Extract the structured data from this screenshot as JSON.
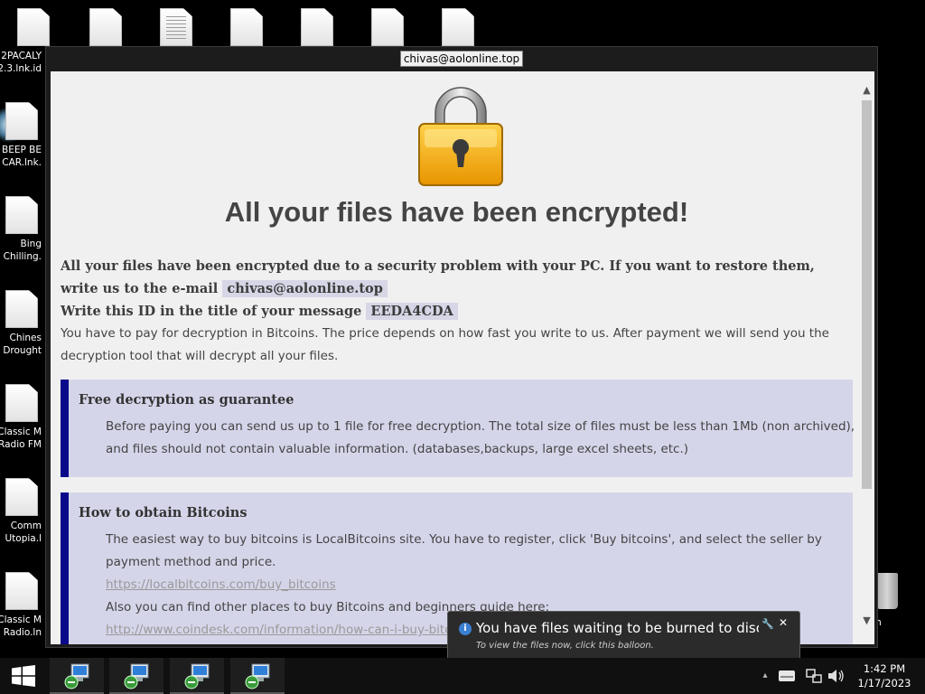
{
  "desktop": {
    "top_icons": [
      {
        "icon": "blank-file-icon"
      },
      {
        "icon": "blank-file-icon"
      },
      {
        "icon": "text-file-icon"
      },
      {
        "icon": "blank-file-icon"
      },
      {
        "icon": "blank-file-icon"
      },
      {
        "icon": "blank-file-icon"
      },
      {
        "icon": "blank-file-icon"
      }
    ],
    "left_icons": [
      {
        "label": "2PACALY\n2.3.lnk.id"
      },
      {
        "label": "BEEP BE\nCAR.lnk."
      },
      {
        "label": "Bing\nChilling."
      },
      {
        "label": "Chines\nDrought"
      },
      {
        "label": "Classic M\nRadio FM"
      },
      {
        "label": "Comm\nUtopia.l"
      },
      {
        "label": "Classic M\nRadio.ln"
      }
    ],
    "right_partial_label": "rn"
  },
  "window": {
    "title": "chivas@aolonline.top",
    "headline": "All your files have been encrypted!",
    "intro_bold_1": "All your files have been encrypted due to a security problem with your PC. If you want to restore them, write us to the e-mail",
    "email": "chivas@aolonline.top",
    "intro_bold_2": "Write this ID in the title of your message",
    "id_code": "EEDA4CDA",
    "intro_text": "You have to pay for decryption in Bitcoins. The price depends on how fast you write to us. After payment we will send you the decryption tool that will decrypt all your files.",
    "box1": {
      "title": "Free decryption as guarantee",
      "text": "Before paying you can send us up to 1 file for free decryption. The total size of files must be less than 1Mb (non archived), and files should not contain valuable information. (databases,backups, large excel sheets, etc.)"
    },
    "box2": {
      "title": "How to obtain Bitcoins",
      "text": "The easiest way to buy bitcoins is LocalBitcoins site. You have to register, click 'Buy bitcoins', and select the seller by payment method and price.",
      "link1": "https://localbitcoins.com/buy_bitcoins",
      "text2": "Also you can find other places to buy Bitcoins and beginners guide here:",
      "link2": "http://www.coindesk.com/information/how-can-i-buy-bitcoins/"
    }
  },
  "notification": {
    "title": "You have files waiting to be burned to disc.",
    "subtitle": "To view the files now, click this balloon.",
    "icon": "info-icon"
  },
  "taskbar": {
    "apps": [
      {
        "icon": "computer-setup-icon"
      },
      {
        "icon": "computer-setup-icon"
      },
      {
        "icon": "computer-setup-icon"
      },
      {
        "icon": "computer-setup-icon"
      }
    ],
    "time": "1:42 PM",
    "date": "1/17/2023"
  },
  "colors": {
    "accent_bar": "#0a0a8a",
    "box_bg": "#d5d5ea",
    "page_bg": "#f0f0f1"
  }
}
